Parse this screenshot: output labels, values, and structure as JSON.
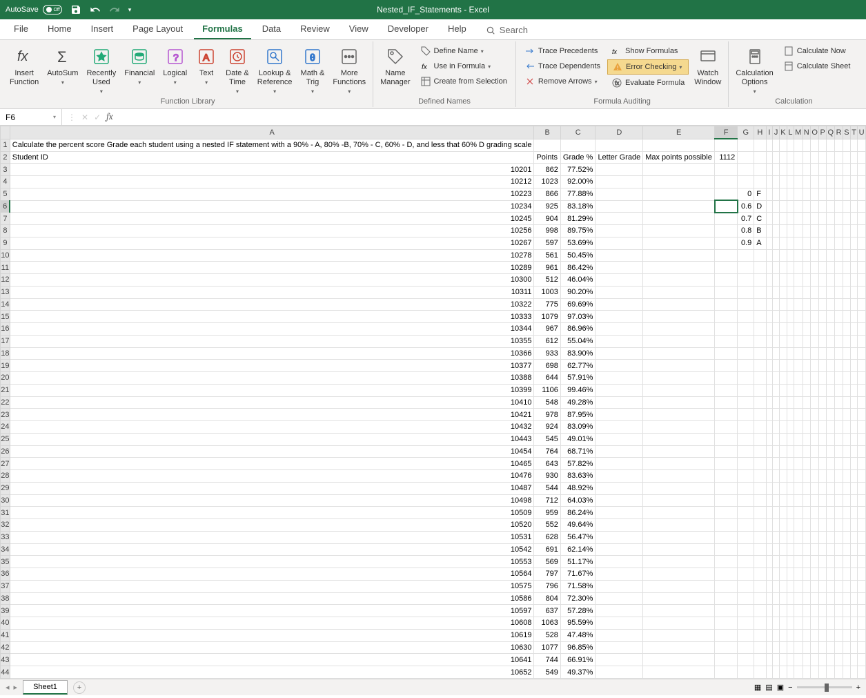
{
  "titlebar": {
    "autosave": "AutoSave",
    "autosave_state": "Off",
    "title": "Nested_IF_Statements  -  Excel"
  },
  "tabs": [
    "File",
    "Home",
    "Insert",
    "Page Layout",
    "Formulas",
    "Data",
    "Review",
    "View",
    "Developer",
    "Help"
  ],
  "active_tab": "Formulas",
  "search_placeholder": "Search",
  "ribbon": {
    "fn_library": {
      "insert_function": "Insert\nFunction",
      "autosum": "AutoSum",
      "recently_used": "Recently\nUsed",
      "financial": "Financial",
      "logical": "Logical",
      "text": "Text",
      "date_time": "Date &\nTime",
      "lookup_ref": "Lookup &\nReference",
      "math_trig": "Math &\nTrig",
      "more_fn": "More\nFunctions",
      "label": "Function Library"
    },
    "defined_names": {
      "name_manager": "Name\nManager",
      "define_name": "Define Name",
      "use_in_formula": "Use in Formula",
      "create_from_sel": "Create from Selection",
      "label": "Defined Names"
    },
    "formula_auditing": {
      "trace_precedents": "Trace Precedents",
      "trace_dependents": "Trace Dependents",
      "remove_arrows": "Remove Arrows",
      "show_formulas": "Show Formulas",
      "error_checking": "Error Checking",
      "evaluate_formula": "Evaluate Formula",
      "watch_window": "Watch\nWindow",
      "label": "Formula Auditing"
    },
    "calculation": {
      "calc_options": "Calculation\nOptions",
      "calc_now": "Calculate Now",
      "calc_sheet": "Calculate Sheet",
      "label": "Calculation"
    }
  },
  "namebox": "F6",
  "formula_bar": "",
  "columns": [
    "A",
    "B",
    "C",
    "D",
    "E",
    "F",
    "G",
    "H",
    "I",
    "J",
    "K",
    "L",
    "M",
    "N",
    "O",
    "P",
    "Q",
    "R",
    "S",
    "T",
    "U"
  ],
  "selected_cell": {
    "row": 6,
    "col": "F"
  },
  "row1_text": "Calculate the percent score Grade each student using a nested IF statement with a 90% - A, 80% -B, 70% - C, 60% - D, and less that 60% D grading scale",
  "headers_row2": {
    "A": "Student ID",
    "B": "Points",
    "C": "Grade %",
    "D": "Letter Grade",
    "E": "Max points possible",
    "F": "1112"
  },
  "lookup_table": [
    {
      "row": 5,
      "G": "0",
      "H": "F"
    },
    {
      "row": 6,
      "G": "0.6",
      "H": "D"
    },
    {
      "row": 7,
      "G": "0.7",
      "H": "C"
    },
    {
      "row": 8,
      "G": "0.8",
      "H": "B"
    },
    {
      "row": 9,
      "G": "0.9",
      "H": "A"
    }
  ],
  "data_rows": [
    {
      "id": "10201",
      "pts": "862",
      "pct": "77.52%"
    },
    {
      "id": "10212",
      "pts": "1023",
      "pct": "92.00%"
    },
    {
      "id": "10223",
      "pts": "866",
      "pct": "77.88%"
    },
    {
      "id": "10234",
      "pts": "925",
      "pct": "83.18%"
    },
    {
      "id": "10245",
      "pts": "904",
      "pct": "81.29%"
    },
    {
      "id": "10256",
      "pts": "998",
      "pct": "89.75%"
    },
    {
      "id": "10267",
      "pts": "597",
      "pct": "53.69%"
    },
    {
      "id": "10278",
      "pts": "561",
      "pct": "50.45%"
    },
    {
      "id": "10289",
      "pts": "961",
      "pct": "86.42%"
    },
    {
      "id": "10300",
      "pts": "512",
      "pct": "46.04%"
    },
    {
      "id": "10311",
      "pts": "1003",
      "pct": "90.20%"
    },
    {
      "id": "10322",
      "pts": "775",
      "pct": "69.69%"
    },
    {
      "id": "10333",
      "pts": "1079",
      "pct": "97.03%"
    },
    {
      "id": "10344",
      "pts": "967",
      "pct": "86.96%"
    },
    {
      "id": "10355",
      "pts": "612",
      "pct": "55.04%"
    },
    {
      "id": "10366",
      "pts": "933",
      "pct": "83.90%"
    },
    {
      "id": "10377",
      "pts": "698",
      "pct": "62.77%"
    },
    {
      "id": "10388",
      "pts": "644",
      "pct": "57.91%"
    },
    {
      "id": "10399",
      "pts": "1106",
      "pct": "99.46%"
    },
    {
      "id": "10410",
      "pts": "548",
      "pct": "49.28%"
    },
    {
      "id": "10421",
      "pts": "978",
      "pct": "87.95%"
    },
    {
      "id": "10432",
      "pts": "924",
      "pct": "83.09%"
    },
    {
      "id": "10443",
      "pts": "545",
      "pct": "49.01%"
    },
    {
      "id": "10454",
      "pts": "764",
      "pct": "68.71%"
    },
    {
      "id": "10465",
      "pts": "643",
      "pct": "57.82%"
    },
    {
      "id": "10476",
      "pts": "930",
      "pct": "83.63%"
    },
    {
      "id": "10487",
      "pts": "544",
      "pct": "48.92%"
    },
    {
      "id": "10498",
      "pts": "712",
      "pct": "64.03%"
    },
    {
      "id": "10509",
      "pts": "959",
      "pct": "86.24%"
    },
    {
      "id": "10520",
      "pts": "552",
      "pct": "49.64%"
    },
    {
      "id": "10531",
      "pts": "628",
      "pct": "56.47%"
    },
    {
      "id": "10542",
      "pts": "691",
      "pct": "62.14%"
    },
    {
      "id": "10553",
      "pts": "569",
      "pct": "51.17%"
    },
    {
      "id": "10564",
      "pts": "797",
      "pct": "71.67%"
    },
    {
      "id": "10575",
      "pts": "796",
      "pct": "71.58%"
    },
    {
      "id": "10586",
      "pts": "804",
      "pct": "72.30%"
    },
    {
      "id": "10597",
      "pts": "637",
      "pct": "57.28%"
    },
    {
      "id": "10608",
      "pts": "1063",
      "pct": "95.59%"
    },
    {
      "id": "10619",
      "pts": "528",
      "pct": "47.48%"
    },
    {
      "id": "10630",
      "pts": "1077",
      "pct": "96.85%"
    },
    {
      "id": "10641",
      "pts": "744",
      "pct": "66.91%"
    },
    {
      "id": "10652",
      "pts": "549",
      "pct": "49.37%"
    }
  ],
  "sheet_tab": "Sheet1"
}
